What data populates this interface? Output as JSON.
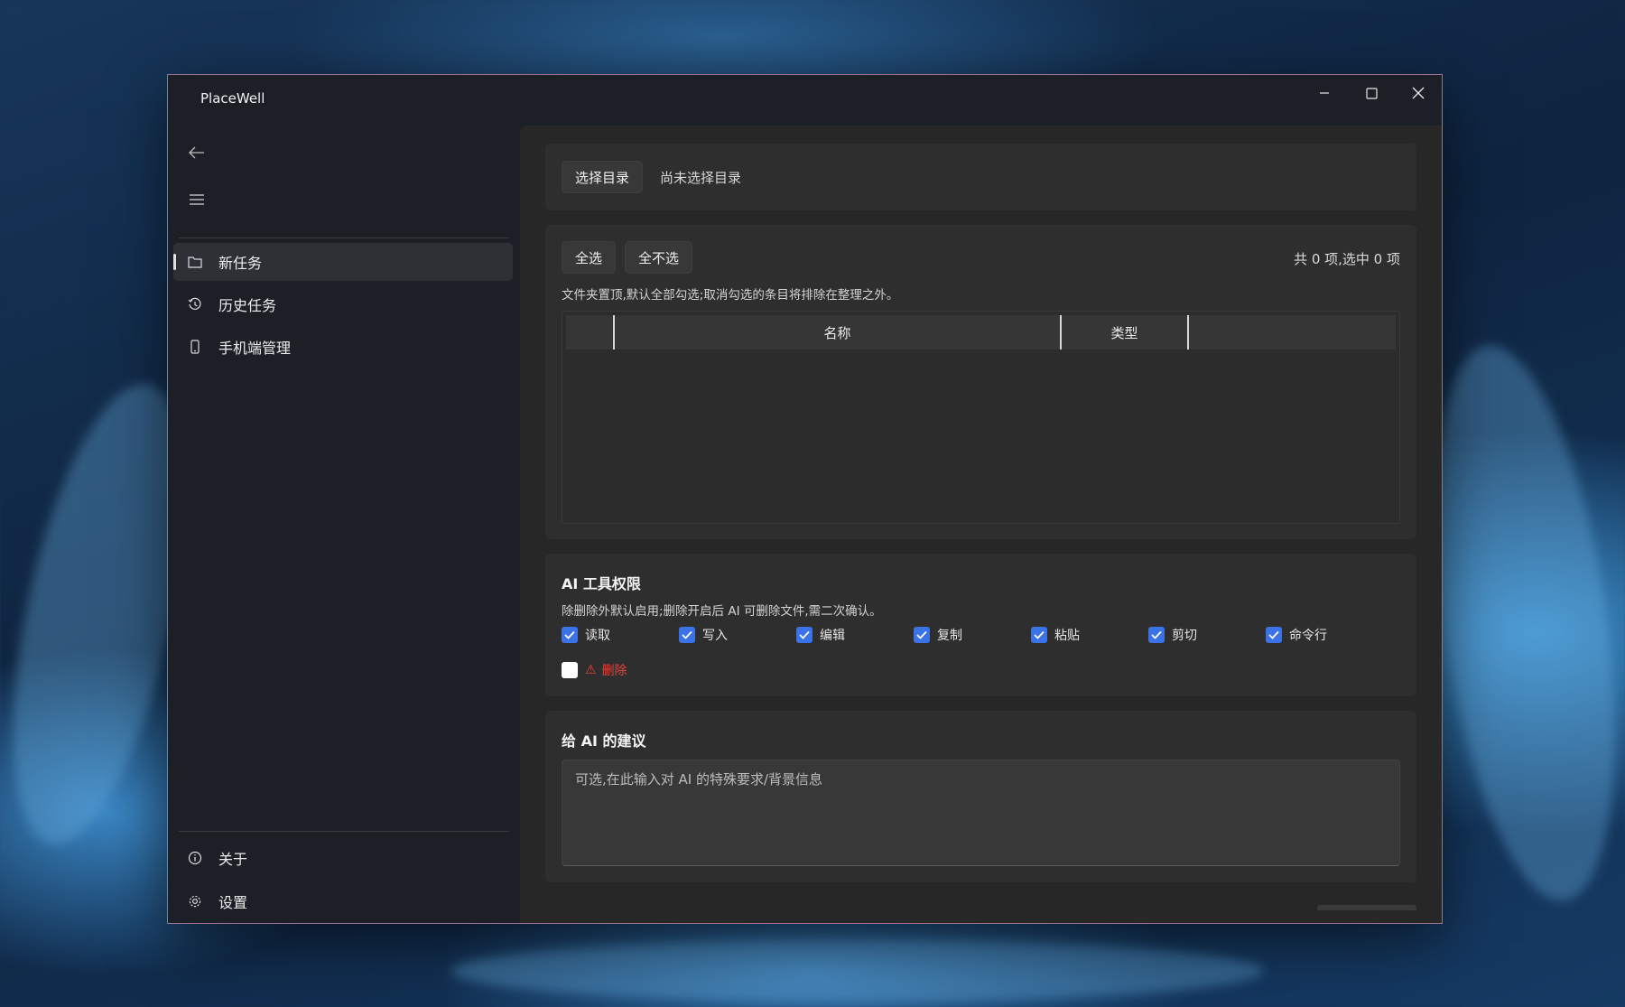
{
  "window": {
    "title": "PlaceWell"
  },
  "sidebar": {
    "items": [
      {
        "label": "新任务",
        "icon": "folder-icon",
        "active": true
      },
      {
        "label": "历史任务",
        "icon": "history-icon",
        "active": false
      },
      {
        "label": "手机端管理",
        "icon": "phone-icon",
        "active": false
      }
    ],
    "footer": [
      {
        "label": "关于",
        "icon": "info-icon"
      },
      {
        "label": "设置",
        "icon": "gear-icon"
      }
    ]
  },
  "directory": {
    "select_button": "选择目录",
    "status": "尚未选择目录"
  },
  "files": {
    "select_all": "全选",
    "select_none": "全不选",
    "summary": "共 0 项,选中 0 项",
    "hint": "文件夹置顶,默认全部勾选;取消勾选的条目将排除在整理之外。",
    "columns": [
      "",
      "名称",
      "类型",
      ""
    ]
  },
  "permissions": {
    "title": "AI 工具权限",
    "hint": "除删除外默认启用;删除开启后 AI 可删除文件,需二次确认。",
    "items": [
      {
        "label": "读取",
        "checked": true
      },
      {
        "label": "写入",
        "checked": true
      },
      {
        "label": "编辑",
        "checked": true
      },
      {
        "label": "复制",
        "checked": true
      },
      {
        "label": "粘贴",
        "checked": true
      },
      {
        "label": "剪切",
        "checked": true
      },
      {
        "label": "命令行",
        "checked": true
      }
    ],
    "delete": {
      "label": "删除",
      "checked": false,
      "warning_icon": "warning-icon"
    }
  },
  "advice": {
    "title": "给 AI 的建议",
    "placeholder": "可选,在此输入对 AI 的特殊要求/背景信息"
  },
  "colors": {
    "accent": "#3b73e6",
    "danger": "#e0453e",
    "window_border": "#9c6f95"
  }
}
